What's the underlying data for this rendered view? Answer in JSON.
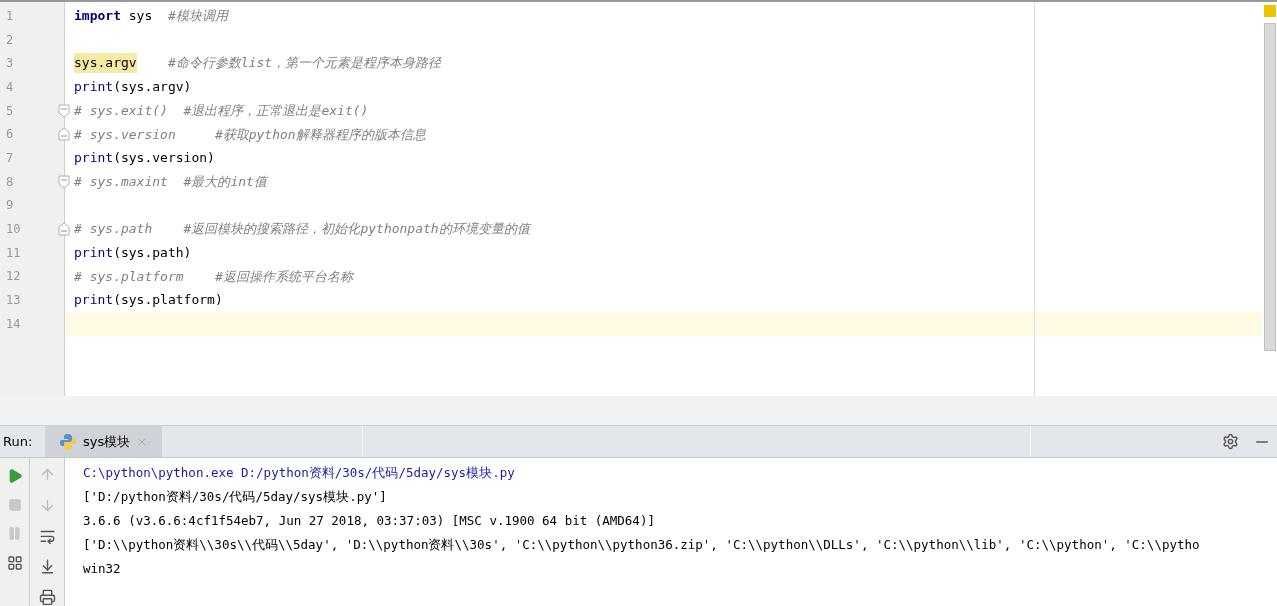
{
  "editor": {
    "lines": [
      {
        "number": "1",
        "fold_start": false,
        "fold_end": false,
        "tokens": [
          {
            "text": "import",
            "kind": "keyword"
          },
          {
            "text": " sys  ",
            "kind": "plain"
          },
          {
            "text": "#模块调用",
            "kind": "comment"
          }
        ]
      },
      {
        "number": "2",
        "fold_start": false,
        "fold_end": false
      },
      {
        "number": "3",
        "fold_start": false,
        "fold_end": false,
        "tokens": [
          {
            "text": "sys.argv",
            "kind": "marked"
          },
          {
            "text": "    #命令行参数list，第一个元素是程序本身路径",
            "kind": "comment"
          }
        ]
      },
      {
        "number": "4",
        "fold_start": false,
        "fold_end": false,
        "tokens": [
          {
            "text": "print",
            "kind": "builtin"
          },
          {
            "text": "(sys.argv)",
            "kind": "plain"
          }
        ]
      },
      {
        "number": "5",
        "fold_start": true,
        "fold_end": false,
        "tokens": [
          {
            "text": "# sys.exit()  #退出程序，正常退出是exit()",
            "kind": "comment"
          }
        ]
      },
      {
        "number": "6",
        "fold_start": false,
        "fold_end": true,
        "tokens": [
          {
            "text": "# sys.version     #获取python解释器程序的版本信息",
            "kind": "comment"
          }
        ]
      },
      {
        "number": "7",
        "fold_start": false,
        "fold_end": false,
        "tokens": [
          {
            "text": "print",
            "kind": "builtin"
          },
          {
            "text": "(sys.version)",
            "kind": "plain"
          }
        ]
      },
      {
        "number": "8",
        "fold_start": true,
        "fold_end": false,
        "tokens": [
          {
            "text": "# sys.maxint  #最大的int值",
            "kind": "comment"
          }
        ]
      },
      {
        "number": "9",
        "fold_start": false,
        "fold_end": false
      },
      {
        "number": "10",
        "fold_start": false,
        "fold_end": true,
        "tokens": [
          {
            "text": "# sys.path    #返回模块的搜索路径，初始化pythonpath的环境变量的值",
            "kind": "comment"
          }
        ]
      },
      {
        "number": "11",
        "fold_start": false,
        "fold_end": false,
        "tokens": [
          {
            "text": "print",
            "kind": "builtin"
          },
          {
            "text": "(sys.path)",
            "kind": "plain"
          }
        ]
      },
      {
        "number": "12",
        "fold_start": false,
        "fold_end": false,
        "tokens": [
          {
            "text": "# sys.platform    #返回操作系统平台名称",
            "kind": "comment"
          }
        ]
      },
      {
        "number": "13",
        "fold_start": false,
        "fold_end": false,
        "tokens": [
          {
            "text": "print",
            "kind": "builtin"
          },
          {
            "text": "(sys.platform)",
            "kind": "plain"
          }
        ]
      },
      {
        "number": "14",
        "fold_start": false,
        "fold_end": false,
        "current": true
      }
    ]
  },
  "run_panel": {
    "label": "Run:",
    "tabs": [
      {
        "title": "sys模块",
        "selected": true
      }
    ],
    "console": [
      {
        "text": "C:\\python\\python.exe D:/python资料/30s/代码/5day/sys模块.py",
        "kind": "command"
      },
      {
        "text": "['D:/python资料/30s/代码/5day/sys模块.py']",
        "kind": "output"
      },
      {
        "text": "3.6.6 (v3.6.6:4cf1f54eb7, Jun 27 2018, 03:37:03) [MSC v.1900 64 bit (AMD64)]",
        "kind": "output"
      },
      {
        "text": "['D:\\\\python资料\\\\30s\\\\代码\\\\5day', 'D:\\\\python资料\\\\30s', 'C:\\\\python\\\\python36.zip', 'C:\\\\python\\\\DLLs', 'C:\\\\python\\\\lib', 'C:\\\\python', 'C:\\\\pytho",
        "kind": "output"
      },
      {
        "text": "win32",
        "kind": "output"
      }
    ]
  }
}
